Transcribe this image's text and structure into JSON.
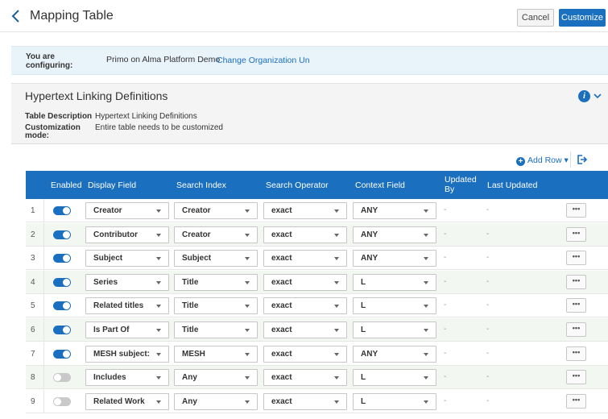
{
  "header": {
    "title": "Mapping Table",
    "cancel_label": "Cancel",
    "customize_label": "Customize"
  },
  "config": {
    "label": "You are configuring:",
    "organization": "Primo on Alma Platform Demo",
    "change_link": "Change Organization Un"
  },
  "definition": {
    "title": "Hypertext Linking Definitions",
    "info_glyph": "i",
    "desc_label": "Table Description",
    "desc_value": "Hypertext Linking Definitions",
    "mode_label": "Customization mode:",
    "mode_value": "Entire table needs to be customized"
  },
  "toolbar": {
    "add_row_label": "Add Row",
    "add_row_caret": "▾",
    "add_icon": "plus-circle-icon",
    "export_icon": "export-icon"
  },
  "table": {
    "columns": {
      "enabled": "Enabled",
      "display_field": "Display Field",
      "search_index": "Search Index",
      "search_operator": "Search Operator",
      "context_field": "Context Field",
      "updated_by": "Updated By",
      "last_updated": "Last Updated"
    },
    "rows": [
      {
        "num": "1",
        "enabled": true,
        "display_field": "Creator",
        "search_index": "Creator",
        "search_operator": "exact",
        "context_field": "ANY",
        "updated_by": "-",
        "last_updated": "-",
        "more": "•••"
      },
      {
        "num": "2",
        "enabled": true,
        "display_field": "Contributor",
        "search_index": "Creator",
        "search_operator": "exact",
        "context_field": "ANY",
        "updated_by": "-",
        "last_updated": "-",
        "more": "•••"
      },
      {
        "num": "3",
        "enabled": true,
        "display_field": "Subject",
        "search_index": "Subject",
        "search_operator": "exact",
        "context_field": "ANY",
        "updated_by": "-",
        "last_updated": "-",
        "more": "•••"
      },
      {
        "num": "4",
        "enabled": true,
        "display_field": "Series",
        "search_index": "Title",
        "search_operator": "exact",
        "context_field": "L",
        "updated_by": "-",
        "last_updated": "-",
        "more": "•••"
      },
      {
        "num": "5",
        "enabled": true,
        "display_field": "Related titles",
        "search_index": "Title",
        "search_operator": "exact",
        "context_field": "L",
        "updated_by": "-",
        "last_updated": "-",
        "more": "•••"
      },
      {
        "num": "6",
        "enabled": true,
        "display_field": "Is Part Of",
        "search_index": "Title",
        "search_operator": "exact",
        "context_field": "L",
        "updated_by": "-",
        "last_updated": "-",
        "more": "•••"
      },
      {
        "num": "7",
        "enabled": true,
        "display_field": "MESH subject:",
        "search_index": "MESH",
        "search_operator": "exact",
        "context_field": "ANY",
        "updated_by": "-",
        "last_updated": "-",
        "more": "•••"
      },
      {
        "num": "8",
        "enabled": false,
        "display_field": "Includes",
        "search_index": "Any",
        "search_operator": "exact",
        "context_field": "L",
        "updated_by": "-",
        "last_updated": "-",
        "more": "•••"
      },
      {
        "num": "9",
        "enabled": false,
        "display_field": "Related Work",
        "search_index": "Any",
        "search_operator": "exact",
        "context_field": "L",
        "updated_by": "-",
        "last_updated": "-",
        "more": "•••"
      }
    ]
  },
  "colors": {
    "accent": "#1a6fbf",
    "row_alt": "#f2f7f2",
    "config_bg": "#e9f3fa",
    "toggle_off": "#c9c9c9"
  }
}
